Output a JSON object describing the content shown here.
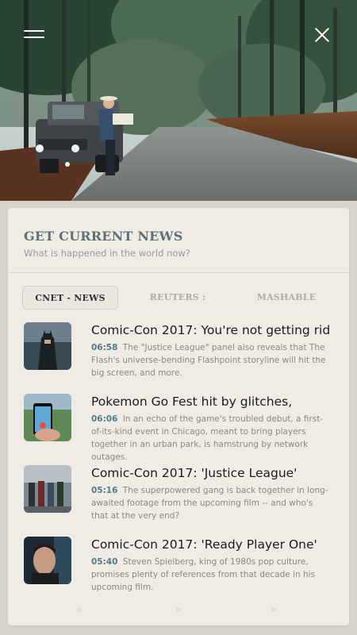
{
  "hero": {
    "menu_icon": "hamburger-menu-icon",
    "close_icon": "close-icon"
  },
  "card": {
    "title": "GET CURRENT NEWS",
    "subtitle": "What is happened in the world now?"
  },
  "tabs": [
    {
      "label": "CNET - NEWS",
      "active": true
    },
    {
      "label": "REUTERS :",
      "active": false
    },
    {
      "label": "MASHABLE",
      "active": false
    }
  ],
  "news": [
    {
      "title": "Comic-Con 2017: You're not getting rid",
      "time": "06:58",
      "body": "The \"Justice League\" panel also reveals that The Flash's universe-bending Flashpoint storyline will hit the big screen, and more."
    },
    {
      "title": "Pokemon Go Fest hit by glitches,",
      "time": "06:06",
      "body": "In an echo of the game's troubled debut, a first-of-its-kind event in Chicago, meant to bring players together in an urban park, is hamstrung by network outages."
    },
    {
      "title": "Comic-Con 2017: 'Justice League'",
      "time": "05:16",
      "body": "The superpowered gang is back together in long-awaited footage from the upcoming film -- and who's that at the very end?"
    },
    {
      "title": "Comic-Con 2017: 'Ready Player One'",
      "time": "05:40",
      "body": "Steven Spielberg, king of 1980s pop culture, promises plenty of references from that decade in his upcoming film."
    }
  ],
  "colors": {
    "accent": "#557a8a",
    "title": "#5f7078",
    "card_bg": "#efebe5",
    "page_bg": "#d8d4cc"
  }
}
